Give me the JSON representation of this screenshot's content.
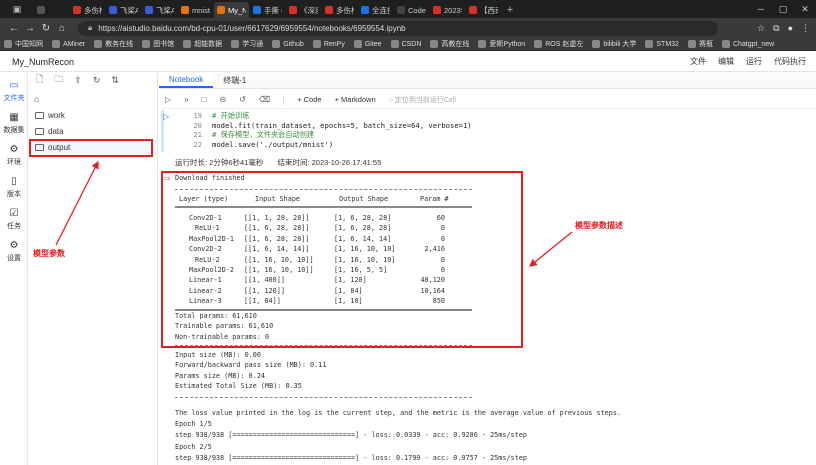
{
  "browser": {
    "tabs": [
      {
        "label": "",
        "color": "#555"
      },
      {
        "label": "多伤桥",
        "color": "#d93025"
      },
      {
        "label": "飞桨AI",
        "color": "#3b5bdb"
      },
      {
        "label": "飞桨AI",
        "color": "#3b5bdb"
      },
      {
        "label": "mnist",
        "color": "#e8710a"
      },
      {
        "label": "My_Nu",
        "color": "#e8710a"
      },
      {
        "label": "手撕 CN",
        "color": "#1a73e8"
      },
      {
        "label": "《深度",
        "color": "#d93025"
      },
      {
        "label": "多伤桥",
        "color": "#d93025"
      },
      {
        "label": "全连接",
        "color": "#1a73e8"
      },
      {
        "label": "CodeIn",
        "color": "#444"
      },
      {
        "label": "2023年",
        "color": "#d93025"
      },
      {
        "label": "【西南",
        "color": "#d93025"
      }
    ],
    "active_tab_index": 5,
    "url": "https://aistudio.baidu.com/bd-cpu-01/user/6617629/6959554/notebooks/6959554.ipynb",
    "bookmarks": [
      "中国知网",
      "AMiner",
      "教务在线",
      "图书馆",
      "超能数据",
      "学习通",
      "Github",
      "RenPy",
      "Gitee",
      "CSDN",
      "高教在线",
      "爱斯Python",
      "ROS 赵虚左",
      "bilibili 大学",
      "STM32",
      "赛瓶",
      "Chatgpt_new"
    ]
  },
  "app": {
    "name": "My_NumRecon",
    "menu": [
      "文件",
      "编辑",
      "运行",
      "代码执行"
    ]
  },
  "activity_bar": [
    {
      "label": "文件夹",
      "icon": "folder-icon",
      "active": true
    },
    {
      "label": "数据集",
      "icon": "dataset-icon",
      "active": false
    },
    {
      "label": "环境",
      "icon": "environment-icon",
      "active": false
    },
    {
      "label": "版本",
      "icon": "version-icon",
      "active": false
    },
    {
      "label": "任务",
      "icon": "task-icon",
      "active": false
    },
    {
      "label": "设置",
      "icon": "gear-icon",
      "active": false
    }
  ],
  "files": [
    {
      "name": "work"
    },
    {
      "name": "data"
    },
    {
      "name": "output",
      "selected": true
    }
  ],
  "editor_tabs": [
    "Notebook",
    "终端-1"
  ],
  "toolbar": {
    "add_code": "+ Code",
    "add_markdown": "+ Markdown",
    "run_all_hint": "定位到当前运行Cell"
  },
  "code_lines": [
    {
      "n": "19",
      "text": "# 开始训练",
      "type": "comment"
    },
    {
      "n": "20",
      "text": "model.fit(train_dataset, epochs=5, batch_size=64, verbose=1)",
      "type": "code"
    },
    {
      "n": "21",
      "text": "# 保存模型，文件夹会自动创建",
      "type": "comment"
    },
    {
      "n": "22",
      "text": "model.save('./output/mnist')",
      "type": "code"
    }
  ],
  "runtime": {
    "duration": "运行时长: 2分钟6秒41毫秒",
    "end_time": "结束时间: 2023-10-26 17:41:55"
  },
  "output": {
    "download_msg": "Download finished",
    "summary_header": {
      "layer": "Layer (type)",
      "input": "Input Shape",
      "output": "Output Shape",
      "params": "Param #"
    },
    "summary_rows": [
      {
        "layer": "Conv2D-1",
        "input": "[[1, 1, 28, 28]]",
        "output": "[1, 6, 28, 28]",
        "params": "60"
      },
      {
        "layer": "ReLU-1",
        "input": "[[1, 6, 28, 28]]",
        "output": "[1, 6, 28, 28]",
        "params": "0"
      },
      {
        "layer": "MaxPool2D-1",
        "input": "[[1, 6, 28, 28]]",
        "output": "[1, 6, 14, 14]",
        "params": "0"
      },
      {
        "layer": "Conv2D-2",
        "input": "[[1, 6, 14, 14]]",
        "output": "[1, 16, 10, 10]",
        "params": "2,416"
      },
      {
        "layer": "ReLU-2",
        "input": "[[1, 16, 10, 10]]",
        "output": "[1, 16, 10, 10]",
        "params": "0"
      },
      {
        "layer": "MaxPool2D-2",
        "input": "[[1, 16, 10, 10]]",
        "output": "[1, 16, 5, 5]",
        "params": "0"
      },
      {
        "layer": "Linear-1",
        "input": "[[1, 400]]",
        "output": "[1, 120]",
        "params": "48,120"
      },
      {
        "layer": "Linear-2",
        "input": "[[1, 120]]",
        "output": "[1, 84]",
        "params": "10,164"
      },
      {
        "layer": "Linear-3",
        "input": "[[1, 84]]",
        "output": "[1, 10]",
        "params": "850"
      }
    ],
    "totals": [
      "Total params: 61,610",
      "Trainable params: 61,610",
      "Non-trainable params: 0"
    ],
    "sizes": [
      "Input size (MB): 0.00",
      "Forward/backward pass size (MB): 0.11",
      "Params size (MB): 0.24",
      "Estimated Total Size (MB): 0.35"
    ],
    "log_lines": [
      "The loss value printed in the log is the current step, and the metric is the average value of previous steps.",
      "Epoch 1/5",
      "step 938/938 [==============================] - loss: 0.0339 - acc: 0.9286 - 25ms/step",
      "Epoch 2/5",
      "step 938/938 [==============================] - loss: 0.1799 - acc: 0.9757 - 25ms/step",
      "Epoch 3/5"
    ]
  },
  "annotations": {
    "left_label": "模型参数",
    "right_label": "模型参数描述",
    "color": "#e02020"
  }
}
